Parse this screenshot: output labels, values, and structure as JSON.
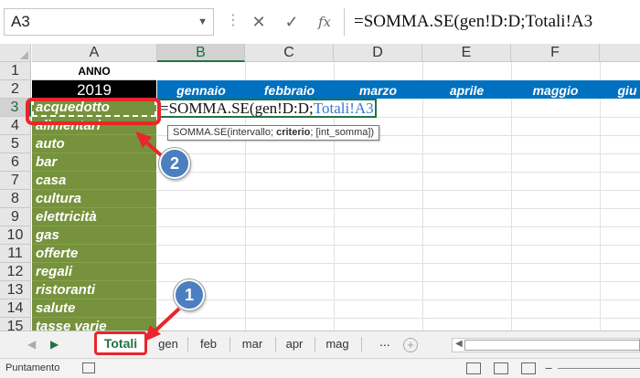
{
  "formula_bar": {
    "name_box": "A3",
    "cancel_icon": "x-icon",
    "enter_icon": "check-icon",
    "function_icon": "fx-icon",
    "fx_label": "fx",
    "formula": "=SOMMA.SE(gen!D:D;Totali!A3"
  },
  "columns": [
    "A",
    "B",
    "C",
    "D",
    "E",
    "F"
  ],
  "rows": [
    "1",
    "2",
    "3",
    "4",
    "5",
    "6",
    "7",
    "8",
    "9",
    "10",
    "11",
    "12",
    "13",
    "14",
    "15"
  ],
  "cells": {
    "anno_label": "ANNO",
    "year": "2019",
    "months": [
      "gennaio",
      "febbraio",
      "marzo",
      "aprile",
      "maggio",
      "giu"
    ],
    "categories": [
      "acquedotto",
      "alimentari",
      "auto",
      "bar",
      "casa",
      "cultura",
      "elettricità",
      "gas",
      "offerte",
      "regali",
      "ristoranti",
      "salute",
      "tasse varie"
    ]
  },
  "edit_cell": {
    "prefix": "=SOMMA.SE(gen!D:D;",
    "ref": "Totali!A3"
  },
  "tooltip": {
    "func": "SOMMA.SE(",
    "arg1": "intervallo; ",
    "arg2": "criterio",
    "arg3": "; [int_somma])"
  },
  "annotations": {
    "badge1": "1",
    "badge2": "2"
  },
  "sheet_tabs": {
    "active": "Totali",
    "others": [
      "gen",
      "feb",
      "mar",
      "apr",
      "mag"
    ],
    "overflow": "...",
    "add": "+"
  },
  "status_bar": {
    "mode": "Puntamento",
    "zoom_minus": "−"
  },
  "colors": {
    "category_fill": "#76923c",
    "month_band": "#0070c0",
    "highlight_red": "#e8262b",
    "badge_blue": "#4c7fc0",
    "excel_green": "#217346"
  }
}
